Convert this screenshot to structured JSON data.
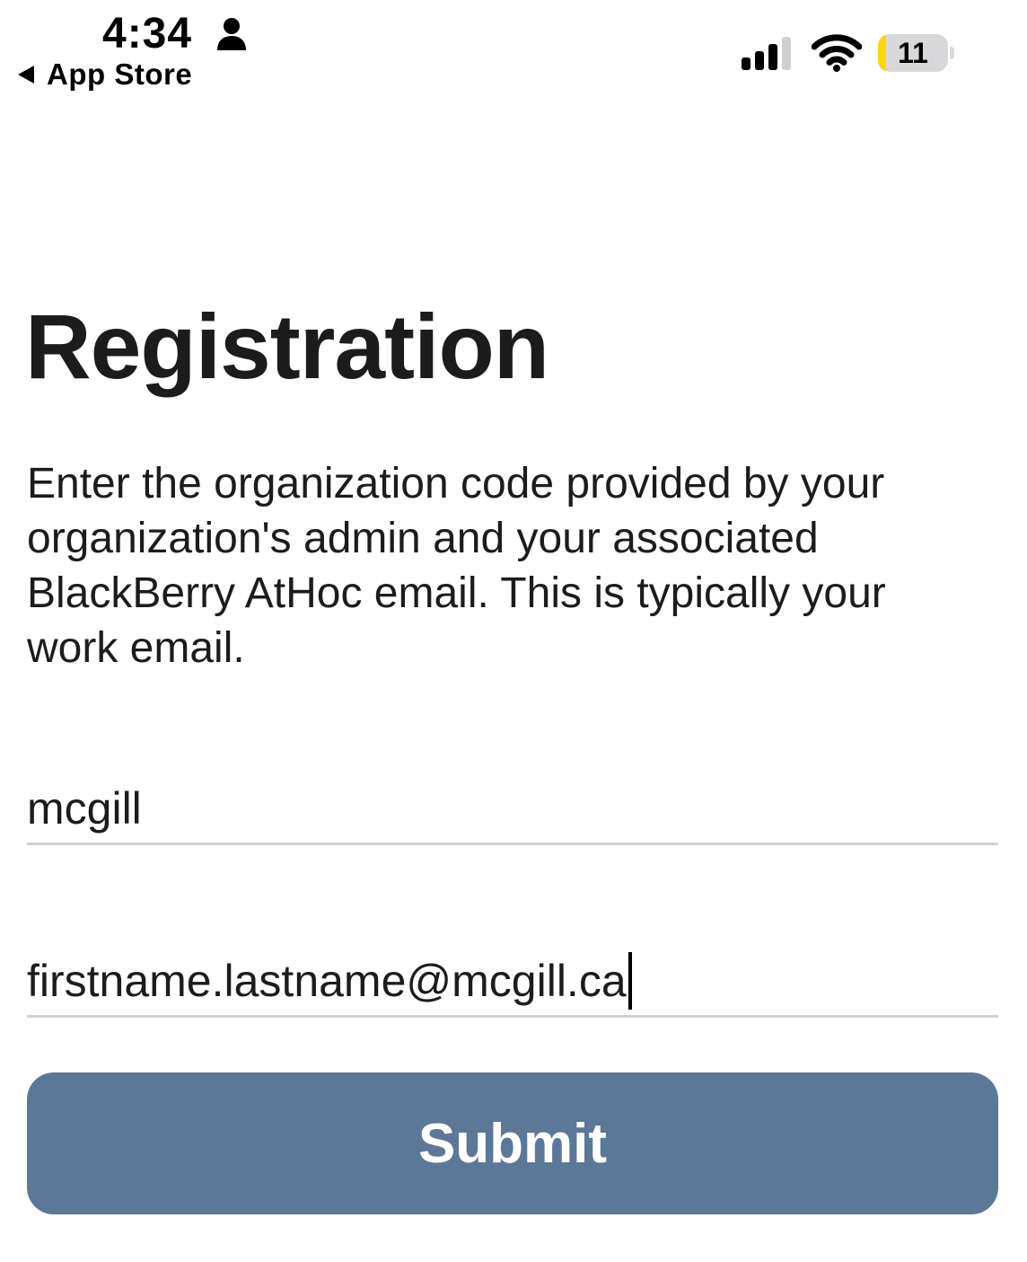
{
  "status_bar": {
    "time": "4:34",
    "back_label": "App Store",
    "battery_level": "11",
    "battery_fraction": 0.11,
    "icons": [
      "person-icon",
      "back-arrow-icon",
      "signal-icon",
      "wifi-icon",
      "battery-icon"
    ]
  },
  "registration": {
    "title": "Registration",
    "description": "Enter the organization code provided by your organization's admin and your associated BlackBerry AtHoc email. This is typically your work email.",
    "org_code_value": "mcgill",
    "email_value": "firstname.lastname@mcgill.ca",
    "submit_label": "Submit"
  },
  "colors": {
    "submit_button": "#5c7899",
    "battery_fill": "#ffd60a",
    "field_underline": "#d1d1d4",
    "text": "#1c1c1e"
  }
}
